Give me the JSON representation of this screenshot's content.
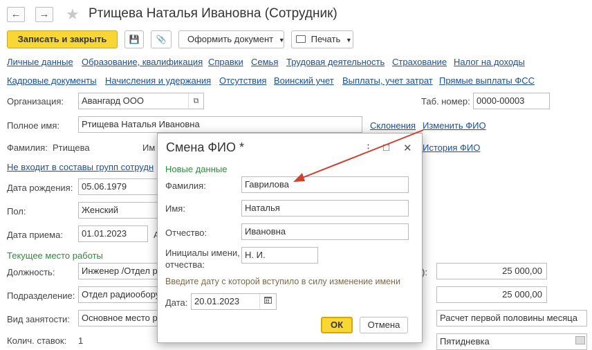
{
  "window": {
    "title": "Ртищева Наталья Ивановна (Сотрудник)",
    "back_icon": "←",
    "forward_icon": "→",
    "star_icon": "★"
  },
  "toolbar": {
    "save_close": "Записать и закрыть",
    "save_icon": "💾",
    "attach_icon": "📎",
    "make_doc": "Оформить документ",
    "print": "Печать"
  },
  "tabs_row1": [
    "Личные данные",
    "Образование, квалификация",
    "Справки",
    "Семья",
    "Трудовая деятельность",
    "Страхование",
    "Налог на доходы"
  ],
  "tabs_row2": [
    "Кадровые документы",
    "Начисления и удержания",
    "Отсутствия",
    "Воинский учет",
    "Выплаты, учет затрат",
    "Прямые выплаты ФСС"
  ],
  "form": {
    "org_label": "Организация:",
    "org_value": "Авангард ООО",
    "tab_num_label": "Таб. номер:",
    "tab_num_value": "0000-00003",
    "full_name_label": "Полное имя:",
    "full_name_value": "Ртищева Наталья Ивановна",
    "declension_link": "Склонения",
    "change_fio_link": "Изменить ФИО",
    "surname_label": "Фамилия:",
    "surname_value": "Ртищева",
    "name_label_partial": "Им",
    "history_link": "История ФИО",
    "groups_link": "Не входит в составы групп сотрудн",
    "birth_label": "Дата рождения:",
    "birth_value": "05.06.1979",
    "gender_label": "Пол:",
    "gender_value": "Женский",
    "hire_label": "Дата приема:",
    "hire_value": "01.01.2023",
    "hire_suffix": "А",
    "workplace_section": "Текущее место работы",
    "position_label": "Должность:",
    "position_value": "Инженер /Отдел р",
    "dept_label": "Подразделение:",
    "dept_value": "Отдел радиообору",
    "employment_label": "Вид занятости:",
    "employment_value": "Основное место р",
    "rate_label": "Колич. ставок:",
    "rate_value": "1",
    "right_label_partial": "):",
    "salary1": "25 000,00",
    "salary2": "25 000,00",
    "advance_calc": "Расчет первой половины месяца",
    "schedule_value": "Пятидневка"
  },
  "dialog": {
    "title": "Смена ФИО *",
    "more_icon": "⋮",
    "maximize_icon": "□",
    "close_icon": "✕",
    "section": "Новые данные",
    "surname_label": "Фамилия:",
    "surname_value": "Гаврилова",
    "name_label": "Имя:",
    "name_value": "Наталья",
    "patronymic_label": "Отчество:",
    "patronymic_value": "Ивановна",
    "initials_label_1": "Инициалы имени,",
    "initials_label_2": "отчества:",
    "initials_value": "Н. И.",
    "hint": "Введите дату с которой вступило в силу изменение имени",
    "date_label": "Дата:",
    "date_value": "20.01.2023",
    "ok": "ОК",
    "cancel": "Отмена"
  },
  "colors": {
    "accent_yellow": "#f8d734",
    "link_blue": "#1a4f9c",
    "section_green": "#2e8b3b",
    "annotation_red": "#d0402f"
  }
}
